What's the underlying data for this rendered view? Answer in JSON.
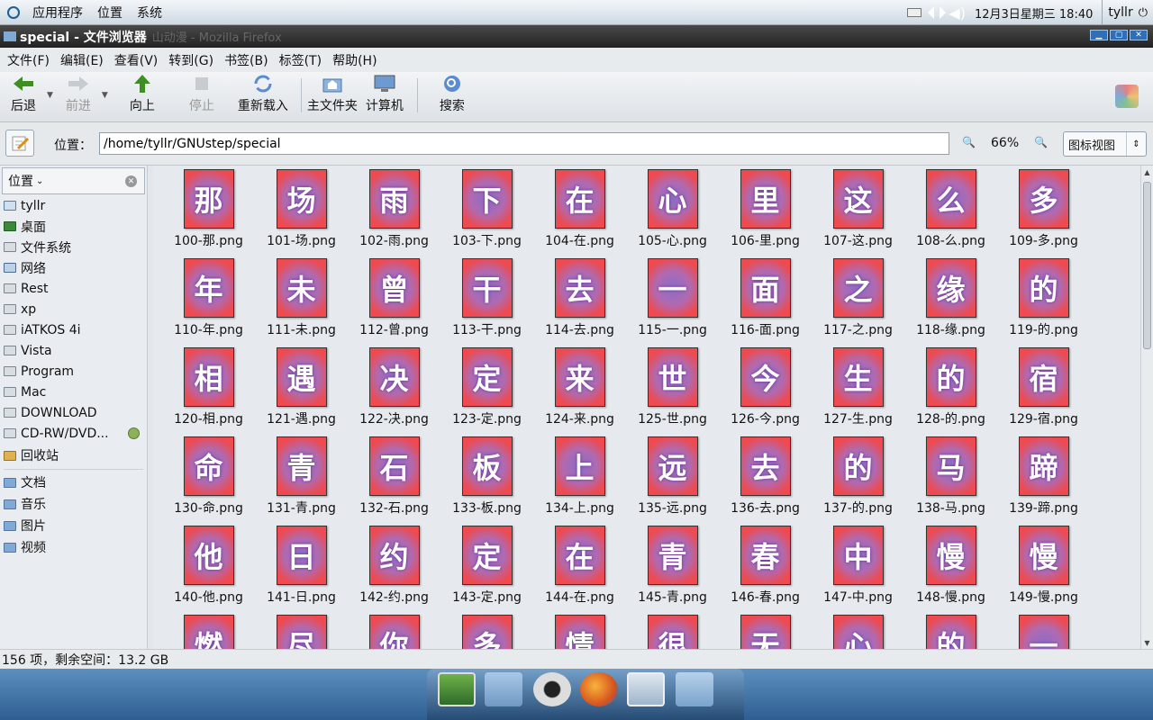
{
  "topbar": {
    "menus": [
      "应用程序",
      "位置",
      "系统"
    ],
    "clock": "12月3日星期三 18:40",
    "user": "tyllr"
  },
  "window": {
    "title": "special - 文件浏览器",
    "ghost_title": "山动漫 - Mozilla Firefox"
  },
  "menubar": [
    "文件(F)",
    "编辑(E)",
    "查看(V)",
    "转到(G)",
    "书签(B)",
    "标签(T)",
    "帮助(H)"
  ],
  "toolbar": {
    "back": "后退",
    "forward": "前进",
    "up": "向上",
    "stop": "停止",
    "reload": "重新载入",
    "home": "主文件夹",
    "computer": "计算机",
    "search": "搜索"
  },
  "location": {
    "label": "位置：",
    "path": "/home/tyllr/GNUstep/special",
    "zoom": "66%",
    "view_mode": "图标视图"
  },
  "sidebar": {
    "header": "位置",
    "items": [
      {
        "label": "tyllr",
        "icon": "home-icon"
      },
      {
        "label": "桌面",
        "icon": "desktop-icon"
      },
      {
        "label": "文件系统",
        "icon": "drive-icon"
      },
      {
        "label": "网络",
        "icon": "network-icon"
      },
      {
        "label": "Rest",
        "icon": "drive-icon"
      },
      {
        "label": "xp",
        "icon": "drive-icon"
      },
      {
        "label": "iATKOS 4i",
        "icon": "drive-icon"
      },
      {
        "label": "Vista",
        "icon": "drive-icon"
      },
      {
        "label": "Program",
        "icon": "drive-icon"
      },
      {
        "label": "Mac",
        "icon": "drive-icon"
      },
      {
        "label": "DOWNLOAD",
        "icon": "drive-icon"
      },
      {
        "label": "CD-RW/DVD...",
        "icon": "optical-drive-icon"
      },
      {
        "label": "回收站",
        "icon": "trash-icon"
      }
    ],
    "bookmarks": [
      {
        "label": "文档",
        "icon": "folder-icon"
      },
      {
        "label": "音乐",
        "icon": "folder-icon"
      },
      {
        "label": "图片",
        "icon": "folder-icon"
      },
      {
        "label": "视频",
        "icon": "folder-icon"
      }
    ]
  },
  "files": [
    {
      "name": "100-那.png",
      "char": "那"
    },
    {
      "name": "101-场.png",
      "char": "场"
    },
    {
      "name": "102-雨.png",
      "char": "雨"
    },
    {
      "name": "103-下.png",
      "char": "下"
    },
    {
      "name": "104-在.png",
      "char": "在"
    },
    {
      "name": "105-心.png",
      "char": "心"
    },
    {
      "name": "106-里.png",
      "char": "里"
    },
    {
      "name": "107-这.png",
      "char": "这"
    },
    {
      "name": "108-么.png",
      "char": "么"
    },
    {
      "name": "109-多.png",
      "char": "多"
    },
    {
      "name": "110-年.png",
      "char": "年"
    },
    {
      "name": "111-未.png",
      "char": "未"
    },
    {
      "name": "112-曾.png",
      "char": "曾"
    },
    {
      "name": "113-干.png",
      "char": "干"
    },
    {
      "name": "114-去.png",
      "char": "去"
    },
    {
      "name": "115-一.png",
      "char": "一"
    },
    {
      "name": "116-面.png",
      "char": "面"
    },
    {
      "name": "117-之.png",
      "char": "之"
    },
    {
      "name": "118-缘.png",
      "char": "缘"
    },
    {
      "name": "119-的.png",
      "char": "的"
    },
    {
      "name": "120-相.png",
      "char": "相"
    },
    {
      "name": "121-遇.png",
      "char": "遇"
    },
    {
      "name": "122-决.png",
      "char": "决"
    },
    {
      "name": "123-定.png",
      "char": "定"
    },
    {
      "name": "124-来.png",
      "char": "来"
    },
    {
      "name": "125-世.png",
      "char": "世"
    },
    {
      "name": "126-今.png",
      "char": "今"
    },
    {
      "name": "127-生.png",
      "char": "生"
    },
    {
      "name": "128-的.png",
      "char": "的"
    },
    {
      "name": "129-宿.png",
      "char": "宿"
    },
    {
      "name": "130-命.png",
      "char": "命"
    },
    {
      "name": "131-青.png",
      "char": "青"
    },
    {
      "name": "132-石.png",
      "char": "石"
    },
    {
      "name": "133-板.png",
      "char": "板"
    },
    {
      "name": "134-上.png",
      "char": "上"
    },
    {
      "name": "135-远.png",
      "char": "远"
    },
    {
      "name": "136-去.png",
      "char": "去"
    },
    {
      "name": "137-的.png",
      "char": "的"
    },
    {
      "name": "138-马.png",
      "char": "马"
    },
    {
      "name": "139-蹄.png",
      "char": "蹄"
    },
    {
      "name": "140-他.png",
      "char": "他"
    },
    {
      "name": "141-日.png",
      "char": "日"
    },
    {
      "name": "142-约.png",
      "char": "约"
    },
    {
      "name": "143-定.png",
      "char": "定"
    },
    {
      "name": "144-在.png",
      "char": "在"
    },
    {
      "name": "145-青.png",
      "char": "青"
    },
    {
      "name": "146-春.png",
      "char": "春"
    },
    {
      "name": "147-中.png",
      "char": "中"
    },
    {
      "name": "148-慢.png",
      "char": "慢"
    },
    {
      "name": "149-慢.png",
      "char": "慢"
    },
    {
      "name": "",
      "char": "燃"
    },
    {
      "name": "",
      "char": "尽"
    },
    {
      "name": "",
      "char": "你"
    },
    {
      "name": "",
      "char": "多"
    },
    {
      "name": "",
      "char": "情"
    },
    {
      "name": "",
      "char": "很"
    },
    {
      "name": "",
      "char": "无"
    },
    {
      "name": "",
      "char": "心"
    },
    {
      "name": "",
      "char": "的"
    },
    {
      "name": "",
      "char": "一"
    }
  ],
  "status": "156 项，剩余空间：13.2 GB"
}
